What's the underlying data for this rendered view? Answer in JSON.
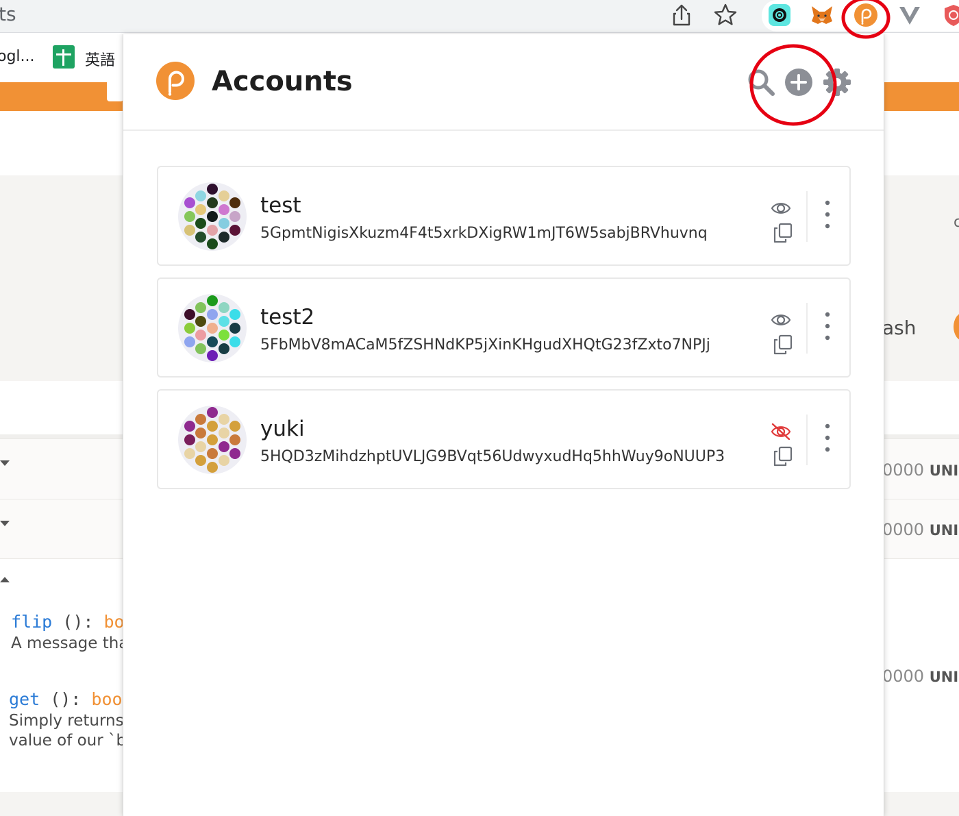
{
  "browser": {
    "tab_title": "ts",
    "bookmarks": [
      {
        "label": "ogl..."
      },
      {
        "label": "英語"
      }
    ]
  },
  "background_page": {
    "methods": [
      {
        "name": "flip",
        "signature": " (): ",
        "return_type": "bo",
        "description": "A message tha"
      },
      {
        "name": "get",
        "signature": " (): ",
        "return_type": "boo",
        "description": "Simply returns",
        "description_line2": "value of our `b"
      }
    ],
    "right_side": {
      "partial_label": "ash",
      "partial_char": "c",
      "amounts": [
        {
          "value": "0000",
          "unit": "UNI"
        },
        {
          "value": "0000",
          "unit": "UNI"
        },
        {
          "value": "0000",
          "unit": "UNI"
        }
      ]
    }
  },
  "popup": {
    "title": "Accounts",
    "header_buttons": {
      "search": "search-icon",
      "add": "plus-circle-icon",
      "settings": "gear-icon"
    },
    "accounts": [
      {
        "name": "test",
        "address": "5GpmtNigisXkuzm4F4t5xrkDXigRW1mJT6W5sabjBRVhuvnq",
        "visible": true,
        "identicon": [
          "#2e0f2e",
          "#8fd6e2",
          "#e5cf97",
          "#a84fd1",
          "#22391c",
          "#4e2c0c",
          "#e6c87a",
          "#cf77d0",
          "#86c75a",
          "#121a1a",
          "#c7a5c8",
          "#1b4b1b",
          "#85cde0",
          "#d7c276",
          "#e3a3a8",
          "#5a1236",
          "#234c2b",
          "#1d2a2a",
          "#1b4b1b",
          "#5a1236",
          "#e5cf97",
          "#c9b45a",
          "#d1b84a"
        ]
      },
      {
        "name": "test2",
        "address": "5FbMbV8mACaM5fZSHNdKP5jXinKHgudXHQtG23fZxto7NPJj",
        "visible": true,
        "identicon": [
          "#1c9a1c",
          "#82c35c",
          "#8fd6c2",
          "#3d0f2a",
          "#8fa5ef",
          "#3bdde9",
          "#4d4b0f",
          "#5ee0e6",
          "#8bcc3b",
          "#f0b08e",
          "#173c44",
          "#ec9ca2",
          "#7de03b",
          "#8fa5ef",
          "#164a58",
          "#3bdde9",
          "#82c35c",
          "#173c44",
          "#6d1fb5",
          "#6d1fb5",
          "#3bdde9",
          "#4d4b0f",
          "#8bcc3b"
        ]
      },
      {
        "name": "yuki",
        "address": "5HQD3zMihdzhptUVLJG9BVqt56UdwyxudHq5hhWuy9oNUUP3",
        "visible": false,
        "identicon": [
          "#8f2a8f",
          "#c97a3c",
          "#e8d4a5",
          "#8f2a8f",
          "#d4a03c",
          "#d4a03c",
          "#c97a3c",
          "#e8d4a5",
          "#7a1f5c",
          "#d4a03c",
          "#c97a3c",
          "#e8d4a5",
          "#8f2a8f",
          "#e8d4a5",
          "#c97a3c",
          "#8f2a8f",
          "#d4a03c",
          "#e8d4a5",
          "#d4a03c",
          "#c97a3c",
          "#8f2a8f",
          "#c97a3c",
          "#8f2a8f"
        ]
      }
    ]
  },
  "colors": {
    "polkadot_orange": "#f19135",
    "annotation_red": "#e60012",
    "icon_grey": "#8c8f96",
    "hidden_red": "#e03a3a"
  }
}
